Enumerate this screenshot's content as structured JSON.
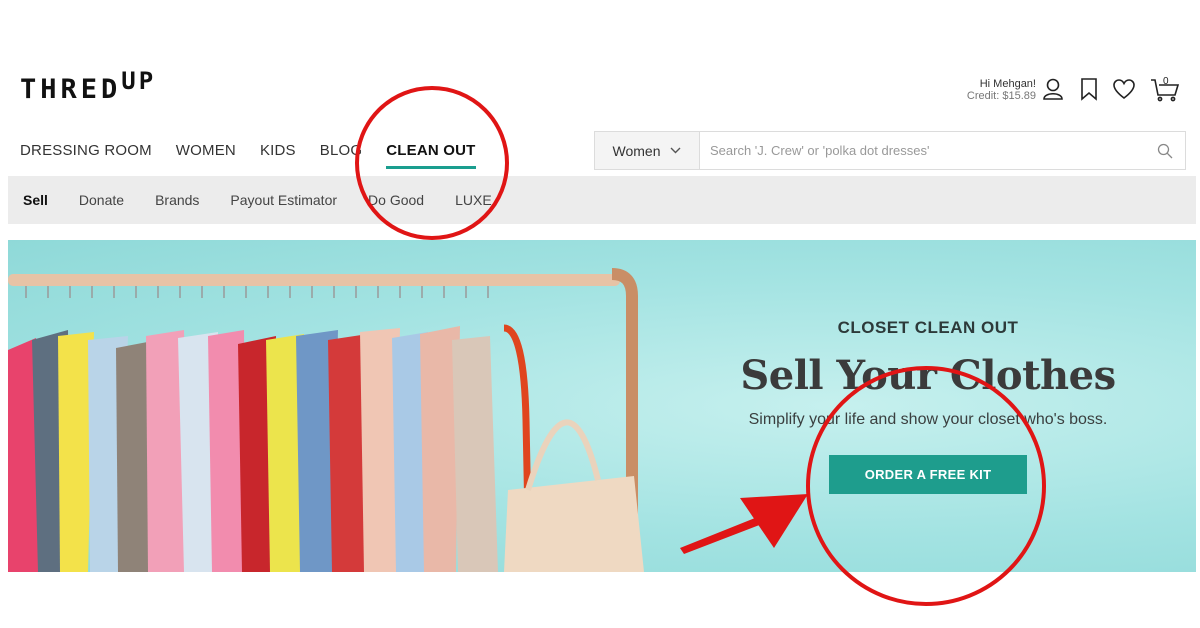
{
  "header": {
    "logo": {
      "main": "THRED",
      "sup": "UP"
    },
    "account": {
      "greeting": "Hi Mehgan!",
      "credit": "Credit: $15.89"
    },
    "icons": [
      "user-icon",
      "bookmark-icon",
      "heart-icon",
      "cart-icon"
    ],
    "cart_count": "0"
  },
  "nav": {
    "items": [
      {
        "label": "DRESSING ROOM"
      },
      {
        "label": "WOMEN"
      },
      {
        "label": "KIDS"
      },
      {
        "label": "BLOG"
      },
      {
        "label": "CLEAN OUT",
        "active": true
      }
    ]
  },
  "search": {
    "category": "Women",
    "placeholder": "Search 'J. Crew' or 'polka dot dresses'"
  },
  "subnav": {
    "items": [
      {
        "label": "Sell",
        "active": true
      },
      {
        "label": "Donate"
      },
      {
        "label": "Brands"
      },
      {
        "label": "Payout Estimator"
      },
      {
        "label": "Do Good"
      },
      {
        "label": "LUXE"
      }
    ]
  },
  "hero": {
    "eyebrow": "CLOSET CLEAN OUT",
    "headline": "Sell Your Clothes",
    "subhead": "Simplify your life and show your closet who's boss.",
    "cta": "ORDER A FREE KIT"
  },
  "colors": {
    "accent": "#1e9d8d",
    "hero_bg": "#a3e3e2",
    "annotation": "#e01515"
  }
}
